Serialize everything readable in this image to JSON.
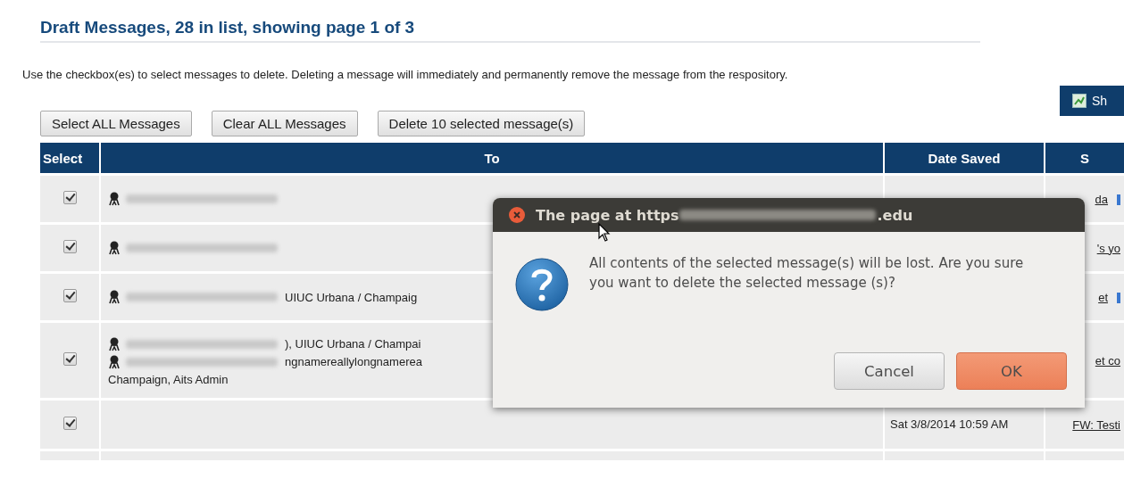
{
  "heading": "Draft Messages, 28 in list, showing page 1 of 3",
  "instructions": "Use the checkbox(es) to select messages to delete. Deleting a message will immediately and permanently remove the message from the respository.",
  "side_button": {
    "label": "Sh"
  },
  "buttons": [
    "Select ALL Messages",
    "Clear ALL Messages",
    "Delete 10 selected message(s)"
  ],
  "table": {
    "columns": [
      "Select",
      "To",
      "Date Saved",
      "S"
    ],
    "rows": [
      {
        "selected": true,
        "recipients": [
          {
            "kind": "person"
          }
        ],
        "note": "",
        "date": "",
        "subject": "da",
        "edit_icon": true
      },
      {
        "selected": true,
        "recipients": [
          {
            "kind": "person"
          }
        ],
        "note": "",
        "date": "",
        "subject": "'s yo",
        "edit_icon": false
      },
      {
        "selected": true,
        "recipients": [
          {
            "kind": "person",
            "suffix": "UIUC Urbana / Champaig"
          }
        ],
        "note": "",
        "date": "",
        "subject": "et",
        "edit_icon": true
      },
      {
        "selected": true,
        "recipients": [
          {
            "kind": "person",
            "suffix": "), UIUC Urbana / Champai"
          },
          {
            "kind": "person",
            "suffix": "ngnamereallylongnamerea"
          }
        ],
        "note": "Champaign, Aits Admin",
        "date": "",
        "subject": "et co",
        "edit_icon": false
      },
      {
        "selected": true,
        "recipients": [],
        "note": "",
        "date": "Sat 3/8/2014 10:59 AM",
        "subject": "FW: Testi",
        "edit_icon": false
      }
    ]
  },
  "dialog": {
    "title": "The page at https",
    "title_end": ".edu",
    "message": "All contents of the selected message(s) will be lost. Are you sure you want to delete the selected message (s)?",
    "buttons": [
      {
        "label": "Cancel",
        "kind": "secondary"
      },
      {
        "label": "OK",
        "kind": "primary"
      }
    ]
  }
}
